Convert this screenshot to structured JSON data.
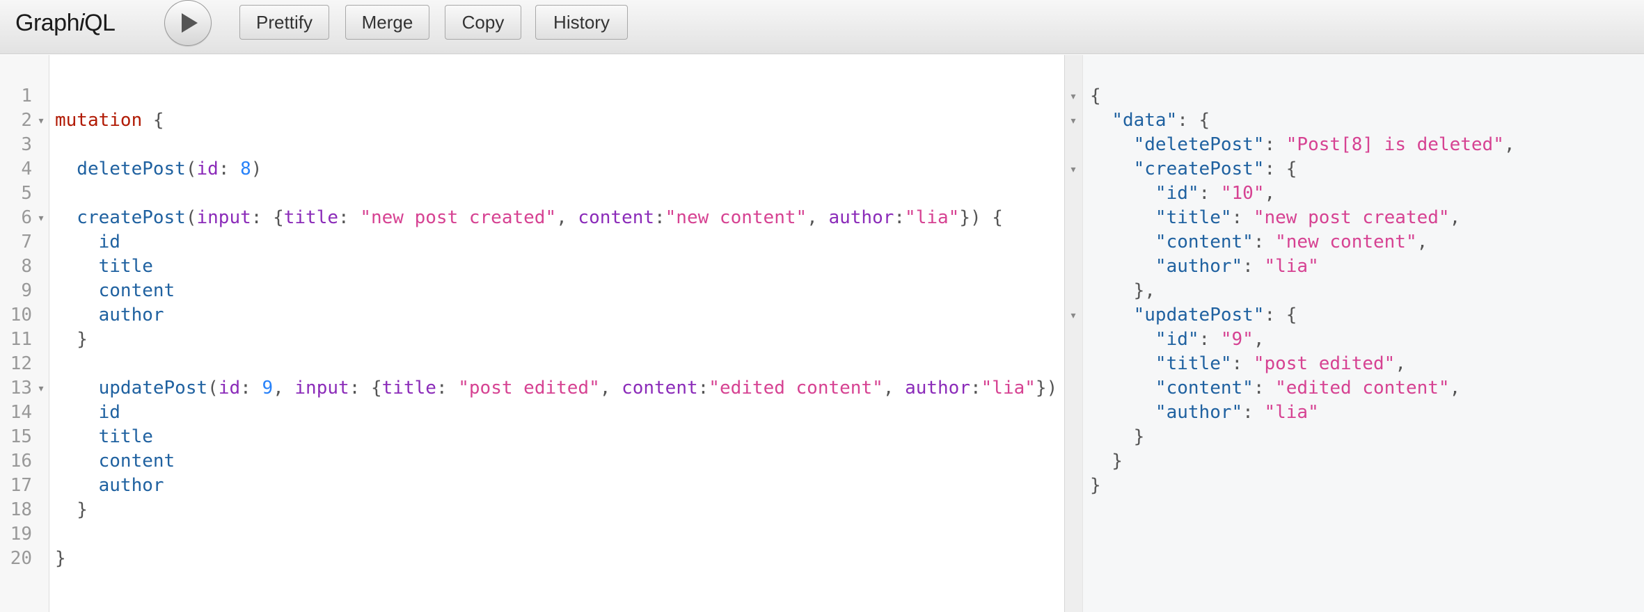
{
  "header": {
    "logo_text_1": "Graph",
    "logo_text_2": "i",
    "logo_text_3": "QL",
    "prettify_label": "Prettify",
    "merge_label": "Merge",
    "copy_label": "Copy",
    "history_label": "History"
  },
  "editor": {
    "line_numbers": [
      "1",
      "2",
      "3",
      "4",
      "5",
      "6",
      "7",
      "8",
      "9",
      "10",
      "11",
      "12",
      "13",
      "14",
      "15",
      "16",
      "17",
      "18",
      "19",
      "20"
    ],
    "lines": [
      [],
      [
        [
          "kw",
          "mutation"
        ],
        [
          "pun",
          " {"
        ]
      ],
      [],
      [
        [
          "def",
          "  deletePost"
        ],
        [
          "pun",
          "("
        ],
        [
          "att",
          "id"
        ],
        [
          "pun",
          ": "
        ],
        [
          "num",
          "8"
        ],
        [
          "pun",
          ")"
        ]
      ],
      [],
      [
        [
          "def",
          "  createPost"
        ],
        [
          "pun",
          "("
        ],
        [
          "att",
          "input"
        ],
        [
          "pun",
          ": {"
        ],
        [
          "att",
          "title"
        ],
        [
          "pun",
          ": "
        ],
        [
          "str",
          "\"new post created\""
        ],
        [
          "pun",
          ", "
        ],
        [
          "att",
          "content"
        ],
        [
          "pun",
          ":"
        ],
        [
          "str",
          "\"new content\""
        ],
        [
          "pun",
          ", "
        ],
        [
          "att",
          "author"
        ],
        [
          "pun",
          ":"
        ],
        [
          "str",
          "\"lia\""
        ],
        [
          "pun",
          "}) {"
        ]
      ],
      [
        [
          "def",
          "    id"
        ]
      ],
      [
        [
          "def",
          "    title"
        ]
      ],
      [
        [
          "def",
          "    content"
        ]
      ],
      [
        [
          "def",
          "    author"
        ]
      ],
      [
        [
          "pun",
          "  }"
        ]
      ],
      [],
      [
        [
          "def",
          "    updatePost"
        ],
        [
          "pun",
          "("
        ],
        [
          "att",
          "id"
        ],
        [
          "pun",
          ": "
        ],
        [
          "num",
          "9"
        ],
        [
          "pun",
          ", "
        ],
        [
          "att",
          "input"
        ],
        [
          "pun",
          ": {"
        ],
        [
          "att",
          "title"
        ],
        [
          "pun",
          ": "
        ],
        [
          "str",
          "\"post edited\""
        ],
        [
          "pun",
          ", "
        ],
        [
          "att",
          "content"
        ],
        [
          "pun",
          ":"
        ],
        [
          "str",
          "\"edited content\""
        ],
        [
          "pun",
          ", "
        ],
        [
          "att",
          "author"
        ],
        [
          "pun",
          ":"
        ],
        [
          "str",
          "\"lia\""
        ],
        [
          "pun",
          "})"
        ]
      ],
      [
        [
          "def",
          "    id"
        ]
      ],
      [
        [
          "def",
          "    title"
        ]
      ],
      [
        [
          "def",
          "    content"
        ]
      ],
      [
        [
          "def",
          "    author"
        ]
      ],
      [
        [
          "pun",
          "  }"
        ]
      ],
      [],
      [
        [
          "pun",
          "}"
        ]
      ]
    ]
  },
  "result": {
    "lines": [
      [
        [
          "pun",
          "{"
        ]
      ],
      [
        [
          "pun",
          "  "
        ],
        [
          "key",
          "\"data\""
        ],
        [
          "pun",
          ": {"
        ]
      ],
      [
        [
          "pun",
          "    "
        ],
        [
          "key",
          "\"deletePost\""
        ],
        [
          "pun",
          ": "
        ],
        [
          "str",
          "\"Post[8] is deleted\""
        ],
        [
          "pun",
          ","
        ]
      ],
      [
        [
          "pun",
          "    "
        ],
        [
          "key",
          "\"createPost\""
        ],
        [
          "pun",
          ": {"
        ]
      ],
      [
        [
          "pun",
          "      "
        ],
        [
          "key",
          "\"id\""
        ],
        [
          "pun",
          ": "
        ],
        [
          "str",
          "\"10\""
        ],
        [
          "pun",
          ","
        ]
      ],
      [
        [
          "pun",
          "      "
        ],
        [
          "key",
          "\"title\""
        ],
        [
          "pun",
          ": "
        ],
        [
          "str",
          "\"new post created\""
        ],
        [
          "pun",
          ","
        ]
      ],
      [
        [
          "pun",
          "      "
        ],
        [
          "key",
          "\"content\""
        ],
        [
          "pun",
          ": "
        ],
        [
          "str",
          "\"new content\""
        ],
        [
          "pun",
          ","
        ]
      ],
      [
        [
          "pun",
          "      "
        ],
        [
          "key",
          "\"author\""
        ],
        [
          "pun",
          ": "
        ],
        [
          "str",
          "\"lia\""
        ]
      ],
      [
        [
          "pun",
          "    },"
        ]
      ],
      [
        [
          "pun",
          "    "
        ],
        [
          "key",
          "\"updatePost\""
        ],
        [
          "pun",
          ": {"
        ]
      ],
      [
        [
          "pun",
          "      "
        ],
        [
          "key",
          "\"id\""
        ],
        [
          "pun",
          ": "
        ],
        [
          "str",
          "\"9\""
        ],
        [
          "pun",
          ","
        ]
      ],
      [
        [
          "pun",
          "      "
        ],
        [
          "key",
          "\"title\""
        ],
        [
          "pun",
          ": "
        ],
        [
          "str",
          "\"post edited\""
        ],
        [
          "pun",
          ","
        ]
      ],
      [
        [
          "pun",
          "      "
        ],
        [
          "key",
          "\"content\""
        ],
        [
          "pun",
          ": "
        ],
        [
          "str",
          "\"edited content\""
        ],
        [
          "pun",
          ","
        ]
      ],
      [
        [
          "pun",
          "      "
        ],
        [
          "key",
          "\"author\""
        ],
        [
          "pun",
          ": "
        ],
        [
          "str",
          "\"lia\""
        ]
      ],
      [
        [
          "pun",
          "    }"
        ]
      ],
      [
        [
          "pun",
          "  }"
        ]
      ],
      [
        [
          "pun",
          "}"
        ]
      ]
    ]
  },
  "icons": {
    "run": "play-icon",
    "fold": "fold-arrow-icon"
  }
}
